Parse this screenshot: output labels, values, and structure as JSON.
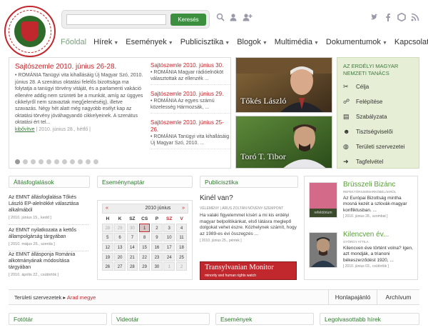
{
  "header": {
    "search_placeholder": "",
    "search_button": "Keresés",
    "icons": [
      "search-icon",
      "user-icon",
      "add-user-icon",
      "twitter-icon",
      "facebook-icon",
      "hexagon-icon",
      "rss-icon"
    ]
  },
  "nav": [
    "Főoldal",
    "Hírek",
    "Események",
    "Publicisztika",
    "Blogok",
    "Multimédia",
    "Dokumentumok",
    "Kapcsolat"
  ],
  "slider": {
    "lead_title": "Sajtószemle 2010. június 26-28.",
    "lead_body": "• ROMÁNIA Tanügyi vita kihallásáig Új Magyar Szó, 2010. június 28. A szenátus oktatási felelős bizottsága ma folytatja a tanügyi törvény vitáját, és a parlamenti vakáció ellenére addig nem szünteti be a munkát, amíg az üggyes cikkelyről nem szavaztak meg(jelenéséig), illetve szavazás. Négy hét alatt még nagyobb esélyt kap az oktatási törvény jóváhagyandó cikkelyeinek. A szenátus oktatási ért tel...",
    "more": "kibővítve",
    "date": "| 2010. június 28., hétfő |",
    "minis": [
      {
        "title": "Sajtószemle 2010. június 30.",
        "body": "• ROMÁNIA Magyar rádióelnököt választottak az ellenzék ..."
      },
      {
        "title": "Sajtószemle 2010. június 29.",
        "body": "• ROMÁNIA Az egyes számú közelesség Hármozsák, ..."
      },
      {
        "title": "Sajtószemle 2010. június 25-26.",
        "body": "• ROMÁNIA Tanügyi vita kihallásáig Új Magyar Szó, 2010. ..."
      }
    ]
  },
  "photos": [
    {
      "name": "Tőkés László"
    },
    {
      "name": "Toró T. Tibor"
    }
  ],
  "panel": {
    "title": "AZ ERDÉLYI MAGYAR NEMZETI TANÁCS",
    "items": [
      {
        "label": "Célja",
        "icon": "tools-icon"
      },
      {
        "label": "Felépítése",
        "icon": "tree-icon"
      },
      {
        "label": "Szabályzata",
        "icon": "document-icon"
      },
      {
        "label": "Tisztségviselői",
        "icon": "people-icon"
      },
      {
        "label": "Területi szervezetei",
        "icon": "globe-icon"
      },
      {
        "label": "Tagfelvétel",
        "icon": "arrow-icon"
      }
    ]
  },
  "sections": {
    "allas": "Állásfoglalások",
    "esemenynaptar": "Eseménynaptár",
    "publicisztika": "Publicisztika"
  },
  "allas_items": [
    {
      "title": "Az EMNT állásfoglalása Tőkés László EP-alelnökké választása alkalmából",
      "date": "[ 2010. június 15., kedd ]"
    },
    {
      "title": "Az EMNT nyilatkozata a kettős állampolgárság tárgyában",
      "date": "[ 2010. május 26., szerda ]"
    },
    {
      "title": "Az EMNT állásponja Románia alkotmányának módosítása tárgyában",
      "date": "[ 2010. április 22., csütörtök ]"
    }
  ],
  "calendar": {
    "title": "2010 június",
    "prev": "«",
    "next": "»",
    "days": [
      "H",
      "K",
      "SZ",
      "CS",
      "P",
      "SZ",
      "V"
    ],
    "cells": [
      {
        "d": "28",
        "o": true
      },
      {
        "d": "29",
        "o": true
      },
      {
        "d": "30",
        "o": true
      },
      {
        "d": "1",
        "t": true
      },
      {
        "d": "2"
      },
      {
        "d": "3"
      },
      {
        "d": "4"
      },
      {
        "d": "5"
      },
      {
        "d": "6"
      },
      {
        "d": "7"
      },
      {
        "d": "8"
      },
      {
        "d": "9"
      },
      {
        "d": "10"
      },
      {
        "d": "11"
      },
      {
        "d": "12"
      },
      {
        "d": "13"
      },
      {
        "d": "14"
      },
      {
        "d": "15"
      },
      {
        "d": "16"
      },
      {
        "d": "17"
      },
      {
        "d": "18"
      },
      {
        "d": "19"
      },
      {
        "d": "20"
      },
      {
        "d": "21"
      },
      {
        "d": "22"
      },
      {
        "d": "23"
      },
      {
        "d": "24"
      },
      {
        "d": "25"
      },
      {
        "d": "26"
      },
      {
        "d": "27"
      },
      {
        "d": "28"
      },
      {
        "d": "29"
      },
      {
        "d": "30"
      },
      {
        "d": "1",
        "o": true
      },
      {
        "d": "2",
        "o": true
      }
    ]
  },
  "kinel": {
    "question": "Kinél van?",
    "source": "VÉLEMÉNY | ÁRUS ZOLTÁN NÖVÉNY-SZEMPONT",
    "body": "Ha valaki figyelemmel kíséri a mi kis erdélyi magyar belpolitikánkat, első látásra meglepő dolgokat vehet észre. Közhelynek számít, hogy az 1989-es évi összegzés ...",
    "date": "[ 2010. június 25., péntek ]"
  },
  "tm": {
    "title": "Transylvanian Monitor",
    "sub": "minority and human rights watch"
  },
  "blog": [
    {
      "title": "Brüsszeli Bizánc",
      "author": "REFEKTÓRIUM/MARKÓBÉLÁKRÓL",
      "body": "Az Európai Bizottság mintha mosná kezét a szlovák-magyar konfliktusban. ...",
      "date": "[ 2010. június 28., szombat ]",
      "img": "refektorium",
      "imgtext": "refektórium"
    },
    {
      "title": "Kilencven év...",
      "author": "GYÖRGY ATTILA",
      "body": "Kilencven éve történt volna? Igen, azt mondják, a trianoni békeszerződést 1920, ...",
      "date": "[ 2010. június 03., csütörtök ]",
      "img": "portrait"
    }
  ],
  "teruleti": {
    "label": "Területi szervezetek",
    "arrow": "▸",
    "value": "Arad megye"
  },
  "bottom_buttons": [
    "Honlapajánló",
    "Archívum"
  ],
  "bottom_tabs": [
    "Fotótár",
    "Videotár",
    "Események",
    "Legolvasottabb hírek"
  ]
}
